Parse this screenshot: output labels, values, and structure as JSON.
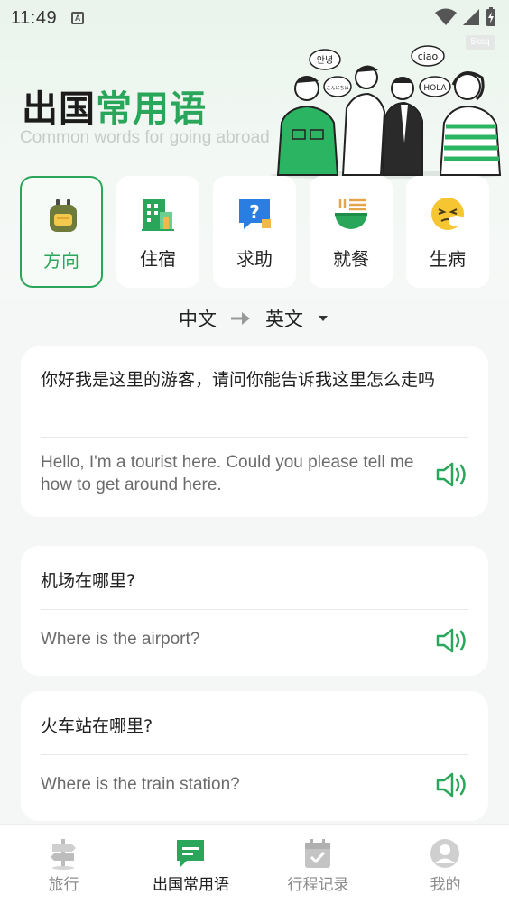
{
  "status_bar": {
    "time": "11:49"
  },
  "watermark": "5ksq",
  "header": {
    "title_part1": "出国",
    "title_part2": "常用语",
    "subtitle": "Common words for going abroad",
    "bubbles": [
      "안녕",
      "こんにちは",
      "ciao",
      "HOLA"
    ]
  },
  "categories": [
    {
      "label": "方向",
      "icon": "backpack-icon",
      "active": true
    },
    {
      "label": "住宿",
      "icon": "hotel-building-icon",
      "active": false
    },
    {
      "label": "求助",
      "icon": "help-question-icon",
      "active": false
    },
    {
      "label": "就餐",
      "icon": "noodle-bowl-icon",
      "active": false
    },
    {
      "label": "生病",
      "icon": "sick-face-icon",
      "active": false
    }
  ],
  "language": {
    "from": "中文",
    "to": "英文"
  },
  "phrases": [
    {
      "zh": "你好我是这里的游客，请问你能告诉我这里怎么走吗",
      "en": "Hello, I'm a tourist here. Could you please tell me how to get around here."
    },
    {
      "zh": "机场在哪里?",
      "en": "Where is the airport?"
    },
    {
      "zh": "火车站在哪里?",
      "en": "Where is the train station?"
    }
  ],
  "bottom_nav": [
    {
      "label": "旅行",
      "icon": "signpost-icon",
      "active": false
    },
    {
      "label": "出国常用语",
      "icon": "chat-message-icon",
      "active": true
    },
    {
      "label": "行程记录",
      "icon": "calendar-check-icon",
      "active": false
    },
    {
      "label": "我的",
      "icon": "user-profile-icon",
      "active": false
    }
  ],
  "colors": {
    "accent": "#2aa65a",
    "card_bg": "#ffffff",
    "page_bg": "#f5f7f6"
  }
}
